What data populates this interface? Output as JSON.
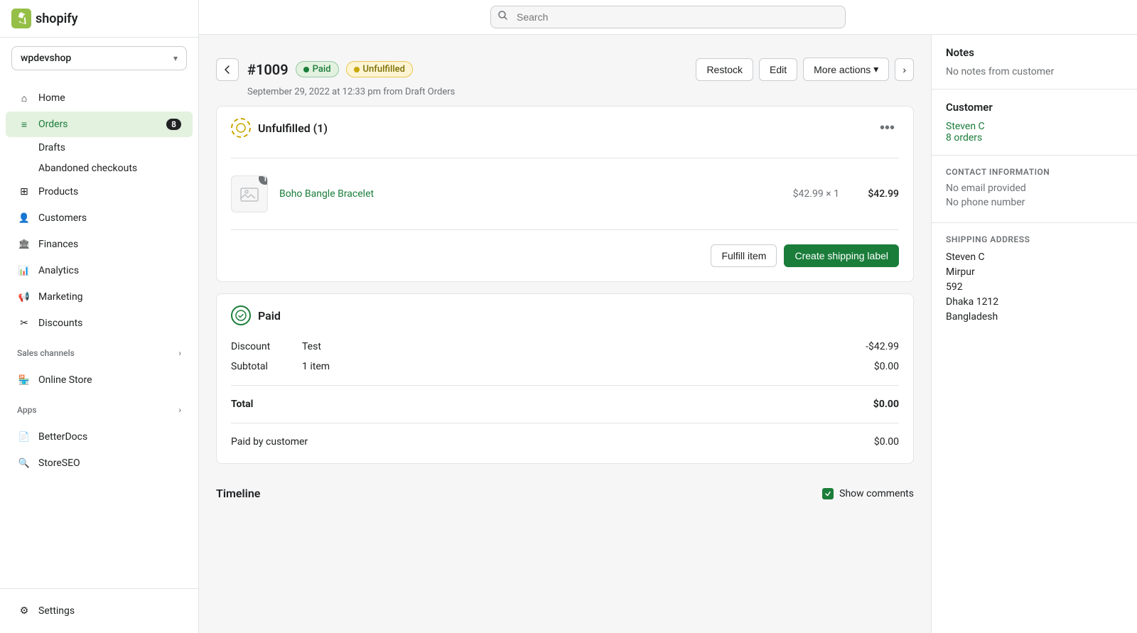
{
  "app": {
    "logo_text": "shopify"
  },
  "sidebar": {
    "store_name": "wpdevshop",
    "nav_items": [
      {
        "id": "home",
        "label": "Home",
        "icon": "home-icon",
        "active": false,
        "badge": null
      },
      {
        "id": "orders",
        "label": "Orders",
        "icon": "orders-icon",
        "active": true,
        "badge": "8"
      },
      {
        "id": "products",
        "label": "Products",
        "icon": "products-icon",
        "active": false,
        "badge": null
      },
      {
        "id": "customers",
        "label": "Customers",
        "icon": "customers-icon",
        "active": false,
        "badge": null
      },
      {
        "id": "finances",
        "label": "Finances",
        "icon": "finances-icon",
        "active": false,
        "badge": null
      },
      {
        "id": "analytics",
        "label": "Analytics",
        "icon": "analytics-icon",
        "active": false,
        "badge": null
      },
      {
        "id": "marketing",
        "label": "Marketing",
        "icon": "marketing-icon",
        "active": false,
        "badge": null
      },
      {
        "id": "discounts",
        "label": "Discounts",
        "icon": "discounts-icon",
        "active": false,
        "badge": null
      }
    ],
    "sub_items": [
      {
        "label": "Drafts"
      },
      {
        "label": "Abandoned checkouts"
      }
    ],
    "sales_channels_label": "Sales channels",
    "sales_channels": [
      {
        "label": "Online Store",
        "icon": "online-store-icon"
      }
    ],
    "apps_label": "Apps",
    "apps": [
      {
        "label": "BetterDocs",
        "icon": "betterdocs-icon"
      },
      {
        "label": "StoreSEO",
        "icon": "storeseo-icon"
      }
    ],
    "settings_label": "Settings"
  },
  "topbar": {
    "search_placeholder": "Search"
  },
  "page": {
    "order_number": "#1009",
    "badge_paid": "Paid",
    "badge_unfulfilled": "Unfulfilled",
    "subtitle": "September 29, 2022 at 12:33 pm from Draft Orders",
    "actions": {
      "restock": "Restock",
      "edit": "Edit",
      "more_actions": "More actions"
    }
  },
  "fulfillment_card": {
    "title": "Unfulfilled (1)",
    "product_name": "Boho Bangle Bracelet",
    "product_quantity": "1",
    "product_price_per": "$42.99 × 1",
    "product_price_total": "$42.99",
    "btn_fulfill": "Fulfill item",
    "btn_shipping": "Create shipping label"
  },
  "payment_card": {
    "title": "Paid",
    "rows": [
      {
        "label": "Discount",
        "desc": "Test",
        "amount": "-$42.99"
      },
      {
        "label": "Subtotal",
        "desc": "1 item",
        "amount": "$0.00"
      }
    ],
    "total_label": "Total",
    "total_amount": "$0.00",
    "paid_by_label": "Paid by customer",
    "paid_by_amount": "$0.00"
  },
  "timeline": {
    "title": "Timeline",
    "show_comments_label": "Show comments"
  },
  "right_panel": {
    "notes_title": "Notes",
    "notes_empty": "No notes from customer",
    "customer_title": "Customer",
    "customer_name": "Steven C",
    "customer_orders": "8 orders",
    "contact_title": "CONTACT INFORMATION",
    "contact_email": "No email provided",
    "contact_phone": "No phone number",
    "shipping_title": "SHIPPING ADDRESS",
    "shipping_name": "Steven C",
    "shipping_street": "Mirpur",
    "shipping_number": "592",
    "shipping_city": "Dhaka 1212",
    "shipping_country": "Bangladesh"
  }
}
